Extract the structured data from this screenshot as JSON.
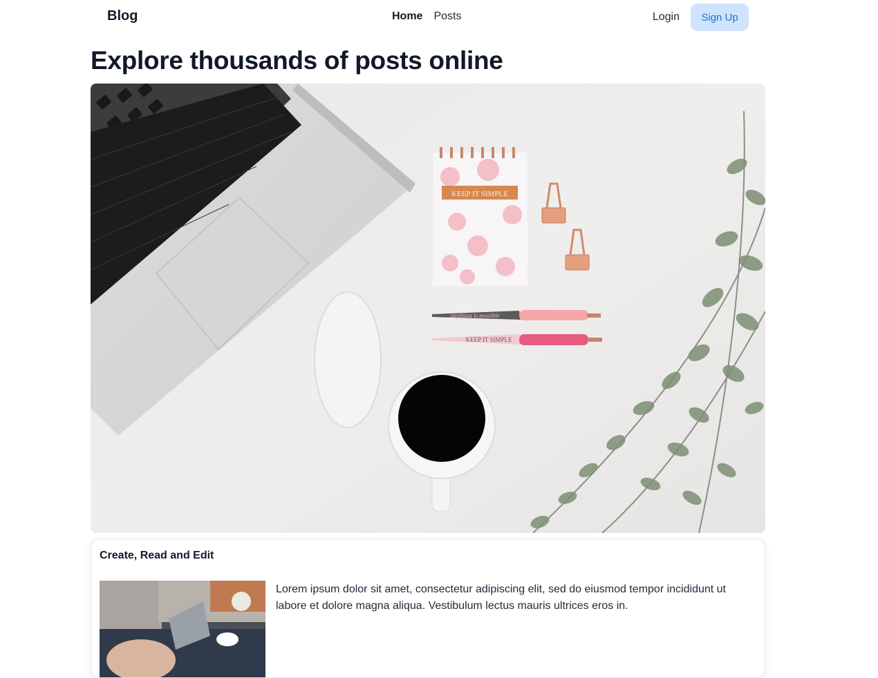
{
  "navbar": {
    "brand": "Blog",
    "links": [
      {
        "label": "Home",
        "active": true
      },
      {
        "label": "Posts",
        "active": false
      }
    ],
    "login_label": "Login",
    "signup_label": "Sign Up"
  },
  "hero": {
    "title": "Explore thousands of posts online",
    "image_text": {
      "notebook": "KEEP IT SIMPLE",
      "pen1": "anything is possible",
      "pen2": "KEEP IT SIMPLE"
    }
  },
  "card": {
    "title": "Create, Read and Edit",
    "body": "Lorem ipsum dolor sit amet, consectetur adipiscing elit, sed do eiusmod tempor incididunt ut labore et dolore magna aliqua. Vestibulum lectus mauris ultrices eros in."
  },
  "colors": {
    "signup_bg": "#cfe3fc",
    "signup_text": "#1d6fd4",
    "heading": "#111827"
  }
}
